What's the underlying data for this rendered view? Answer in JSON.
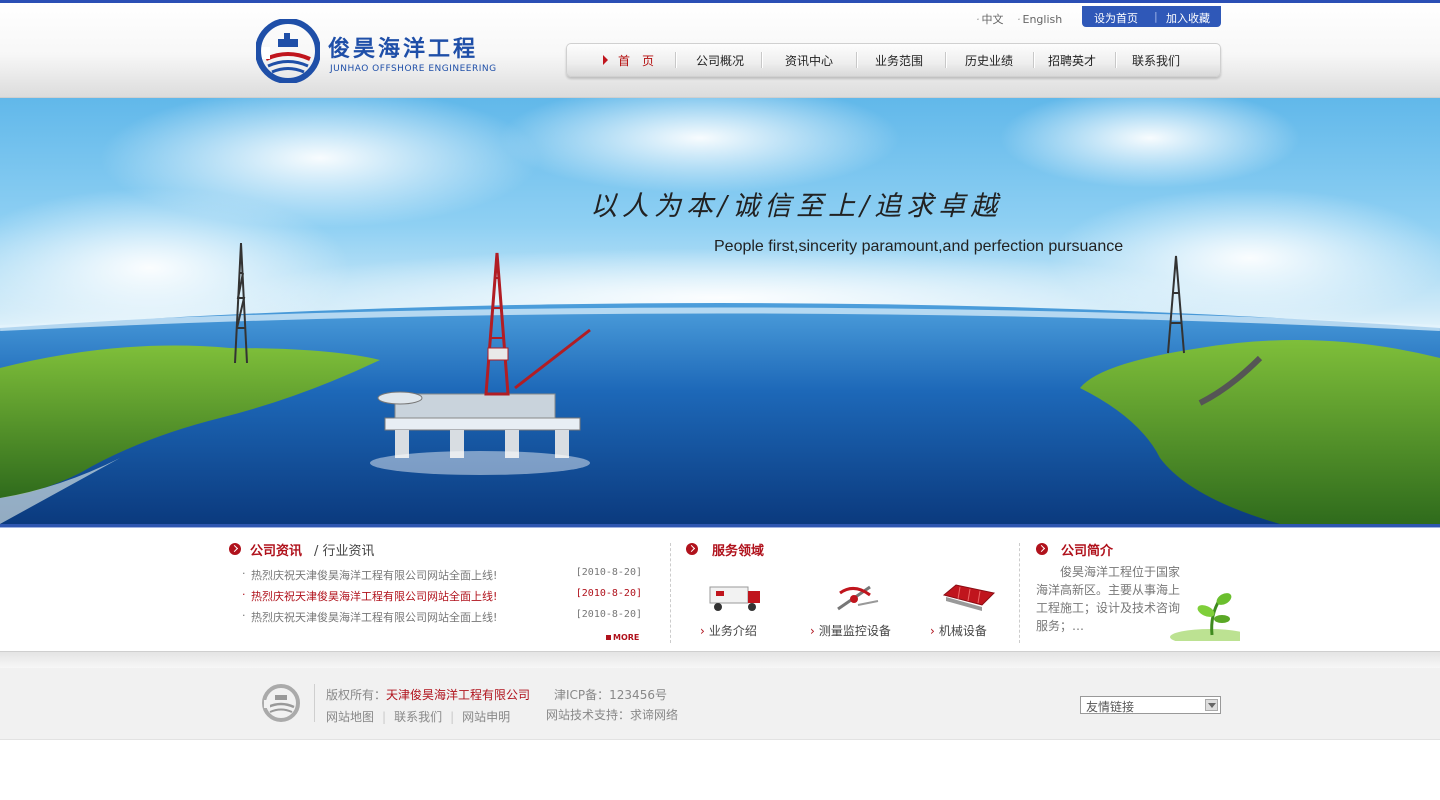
{
  "header": {
    "logo_cn": "俊昊海洋工程",
    "logo_en": "JUNHAO OFFSHORE ENGINEERING",
    "lang": [
      "中文",
      "English"
    ],
    "quick_links": [
      "设为首页",
      "加入收藏"
    ],
    "nav": [
      "首　页",
      "公司概况",
      "资讯中心",
      "业务范围",
      "历史业绩",
      "招聘英才",
      "联系我们"
    ]
  },
  "banner": {
    "slogan_cn": "以人为本/诚信至上/追求卓越",
    "slogan_en": "People first,sincerity paramount,and perfection pursuance"
  },
  "news": {
    "title": "公司资讯",
    "subtitle": "/ 行业资讯",
    "items": [
      {
        "title": "热烈庆祝天津俊昊海洋工程有限公司网站全面上线!",
        "date": "[2010-8-20]"
      },
      {
        "title": "热烈庆祝天津俊昊海洋工程有限公司网站全面上线!",
        "date": "[2010-8-20]"
      },
      {
        "title": "热烈庆祝天津俊昊海洋工程有限公司网站全面上线!",
        "date": "[2010-8-20]"
      }
    ],
    "more": "MORE"
  },
  "services": {
    "title": "服务领域",
    "items": [
      "业务介绍",
      "测量监控设备",
      "机械设备"
    ]
  },
  "about": {
    "title": "公司简介",
    "text": "俊昊海洋工程位于国家海洋高新区。主要从事海上工程施工；设计及技术咨询服务；…"
  },
  "footer": {
    "copyright_label": "版权所有：",
    "company": "天津俊昊海洋工程有限公司",
    "icp": "津ICP备：123456号",
    "links": [
      "网站地图",
      "联系我们",
      "网站申明"
    ],
    "support": "网站技术支持：求谛网络",
    "friend_links": "友情链接"
  },
  "colors": {
    "brand_blue": "#2b4fb5",
    "accent_red": "#b0121c"
  }
}
